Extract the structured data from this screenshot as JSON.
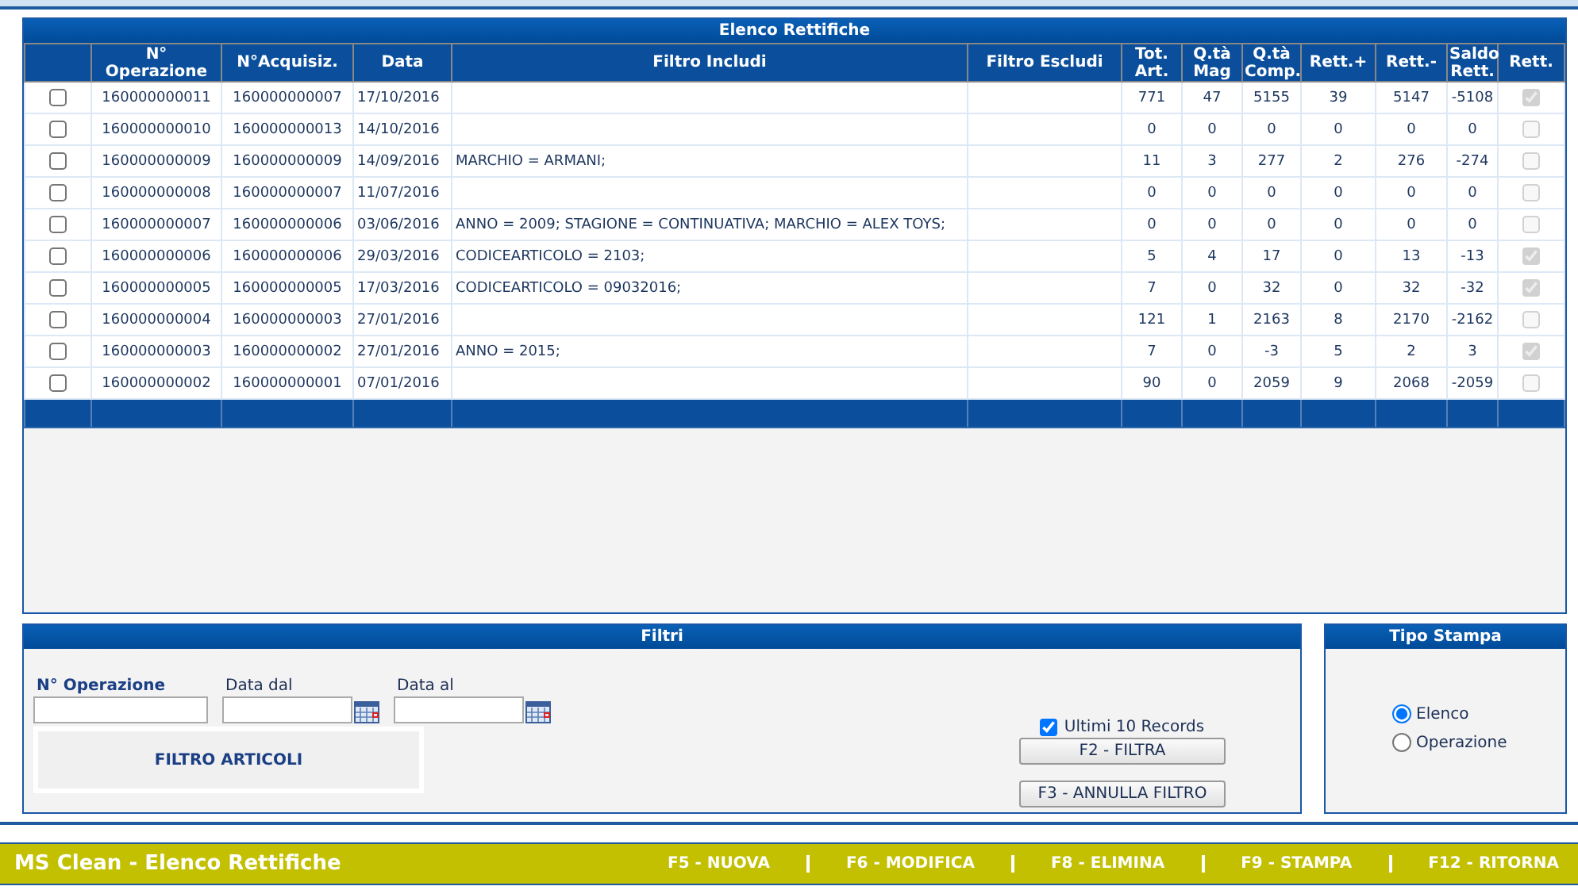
{
  "table": {
    "title": "Elenco Rettifiche",
    "columns": [
      "N° Operazione",
      "N°Acquisiz.",
      "Data",
      "Filtro Includi",
      "Filtro Escludi",
      "Tot. Art.",
      "Q.tà Mag",
      "Q.tà Comp.",
      "Rett.+",
      "Rett.-",
      "Saldo Rett.",
      "Rett."
    ],
    "rows": [
      {
        "selected": false,
        "operazione": "160000000011",
        "acquisizione": "160000000007",
        "data": "17/10/2016",
        "tot_art": "771",
        "qta_mag": "47",
        "qta_comp": "5155",
        "rett_plus": "39",
        "rett_minus": "5147",
        "saldo": "-5108",
        "rett": true
      },
      {
        "selected": false,
        "operazione": "160000000010",
        "acquisizione": "160000000013",
        "data": "14/10/2016",
        "tot_art": "0",
        "qta_mag": "0",
        "qta_comp": "0",
        "rett_plus": "0",
        "rett_minus": "0",
        "saldo": "0",
        "rett": false
      },
      {
        "selected": false,
        "operazione": "160000000009",
        "acquisizione": "160000000009",
        "data": "14/09/2016",
        "filtro_includi": "MARCHIO = ARMANI;",
        "tot_art": "11",
        "qta_mag": "3",
        "qta_comp": "277",
        "rett_plus": "2",
        "rett_minus": "276",
        "saldo": "-274",
        "rett": false
      },
      {
        "selected": false,
        "operazione": "160000000008",
        "acquisizione": "160000000007",
        "data": "11/07/2016",
        "tot_art": "0",
        "qta_mag": "0",
        "qta_comp": "0",
        "rett_plus": "0",
        "rett_minus": "0",
        "saldo": "0",
        "rett": false
      },
      {
        "selected": false,
        "operazione": "160000000007",
        "acquisizione": "160000000006",
        "data": "03/06/2016",
        "filtro_includi": "ANNO = 2009; STAGIONE = CONTINUATIVA; MARCHIO = ALEX TOYS;",
        "tot_art": "0",
        "qta_mag": "0",
        "qta_comp": "0",
        "rett_plus": "0",
        "rett_minus": "0",
        "saldo": "0",
        "rett": false
      },
      {
        "selected": false,
        "operazione": "160000000006",
        "acquisizione": "160000000006",
        "data": "29/03/2016",
        "filtro_includi": "CODICEARTICOLO = 2103;",
        "tot_art": "5",
        "qta_mag": "4",
        "qta_comp": "17",
        "rett_plus": "0",
        "rett_minus": "13",
        "saldo": "-13",
        "rett": true
      },
      {
        "selected": false,
        "operazione": "160000000005",
        "acquisizione": "160000000005",
        "data": "17/03/2016",
        "filtro_includi": "CODICEARTICOLO = 09032016;",
        "tot_art": "7",
        "qta_mag": "0",
        "qta_comp": "32",
        "rett_plus": "0",
        "rett_minus": "32",
        "saldo": "-32",
        "rett": true
      },
      {
        "selected": false,
        "operazione": "160000000004",
        "acquisizione": "160000000003",
        "data": "27/01/2016",
        "tot_art": "121",
        "qta_mag": "1",
        "qta_comp": "2163",
        "rett_plus": "8",
        "rett_minus": "2170",
        "saldo": "-2162",
        "rett": false
      },
      {
        "selected": false,
        "operazione": "160000000003",
        "acquisizione": "160000000002",
        "data": "27/01/2016",
        "filtro_includi": "ANNO = 2015;",
        "tot_art": "7",
        "qta_mag": "0",
        "qta_comp": "-3",
        "rett_plus": "5",
        "rett_minus": "2",
        "saldo": "3",
        "rett": true
      },
      {
        "selected": false,
        "operazione": "160000000002",
        "acquisizione": "160000000001",
        "data": "07/01/2016",
        "tot_art": "90",
        "qta_mag": "0",
        "qta_comp": "2059",
        "rett_plus": "9",
        "rett_minus": "2068",
        "saldo": "-2059",
        "rett": false
      }
    ]
  },
  "filters": {
    "title": "Filtri",
    "fields": [
      {
        "label": "N° Operazione",
        "kind": "text"
      },
      {
        "label": "Data dal",
        "kind": "date"
      },
      {
        "label": "Data al",
        "kind": "date"
      }
    ],
    "articles_button": "FILTRO ARTICOLI",
    "last_records": {
      "label": "Ultimi 10 Records",
      "checked": true
    },
    "buttons": [
      "F2 - FILTRA",
      "F3 - ANNULLA FILTRO"
    ]
  },
  "print_type": {
    "title": "Tipo Stampa",
    "options": [
      {
        "label": "Elenco",
        "selected": true
      },
      {
        "label": "Operazione",
        "selected": false
      }
    ]
  },
  "footer": {
    "title": "MS Clean - Elenco Rettifiche",
    "actions": [
      "F5 - NUOVA",
      "F6 - MODIFICA",
      "F8 - ELIMINA",
      "F9 - STAMPA",
      "F12 - RITORNA"
    ]
  }
}
